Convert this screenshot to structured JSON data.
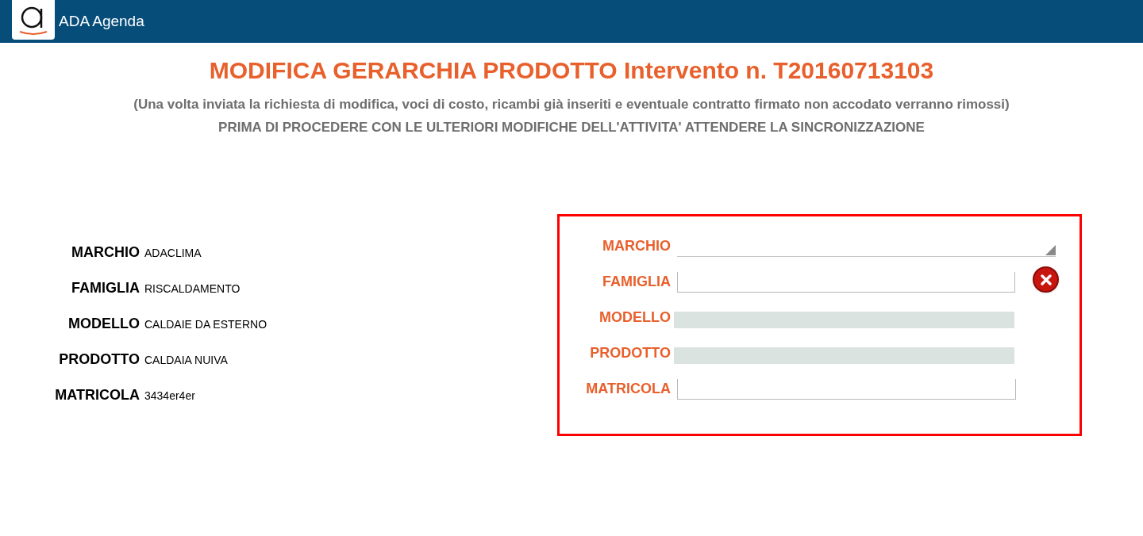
{
  "app_bar": {
    "title": "ADA Agenda"
  },
  "heading": {
    "title": "MODIFICA GERARCHIA PRODOTTO Intervento n. T20160713103",
    "note": "(Una volta inviata la richiesta di modifica, voci di costo, ricambi già inseriti e eventuale contratto firmato non accodato verranno rimossi)",
    "warning": "PRIMA DI PROCEDERE CON LE ULTERIORI MODIFICHE DELL'ATTIVITA' ATTENDERE LA SINCRONIZZAZIONE"
  },
  "current": [
    {
      "label": "MARCHIO",
      "value": "ADACLIMA"
    },
    {
      "label": "FAMIGLIA",
      "value": "RISCALDAMENTO"
    },
    {
      "label": "MODELLO",
      "value": "CALDAIE DA ESTERNO"
    },
    {
      "label": "PRODOTTO",
      "value": "CALDAIA NUIVA"
    },
    {
      "label": "MATRICOLA",
      "value": "3434er4er"
    }
  ],
  "form": [
    {
      "label": "MARCHIO",
      "kind": "select"
    },
    {
      "label": "FAMIGLIA",
      "kind": "clearable"
    },
    {
      "label": "MODELLO",
      "kind": "disabled"
    },
    {
      "label": "PRODOTTO",
      "kind": "disabled"
    },
    {
      "label": "MATRICOLA",
      "kind": "text"
    }
  ]
}
